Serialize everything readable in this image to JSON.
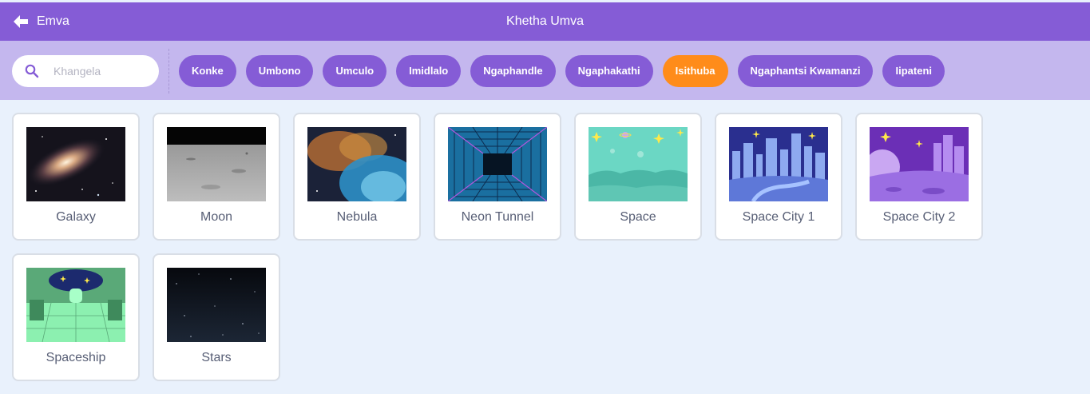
{
  "header": {
    "back_label": "Emva",
    "title": "Khetha Umva"
  },
  "search": {
    "placeholder": "Khangela"
  },
  "tags": [
    {
      "label": "Konke",
      "active": false
    },
    {
      "label": "Umbono",
      "active": false
    },
    {
      "label": "Umculo",
      "active": false
    },
    {
      "label": "Imidlalo",
      "active": false
    },
    {
      "label": "Ngaphandle",
      "active": false
    },
    {
      "label": "Ngaphakathi",
      "active": false
    },
    {
      "label": "Isithuba",
      "active": true
    },
    {
      "label": "Ngaphantsi Kwamanzi",
      "active": false
    },
    {
      "label": "Iipateni",
      "active": false
    }
  ],
  "backdrops": [
    {
      "name": "Galaxy"
    },
    {
      "name": "Moon"
    },
    {
      "name": "Nebula"
    },
    {
      "name": "Neon Tunnel"
    },
    {
      "name": "Space"
    },
    {
      "name": "Space City 1"
    },
    {
      "name": "Space City 2"
    },
    {
      "name": "Spaceship"
    },
    {
      "name": "Stars"
    }
  ],
  "colors": {
    "header": "#855cd6",
    "filter_bar": "#c4b7ee",
    "tag": "#855cd6",
    "tag_active": "#ff8c1a",
    "background": "#e9f1fc"
  }
}
